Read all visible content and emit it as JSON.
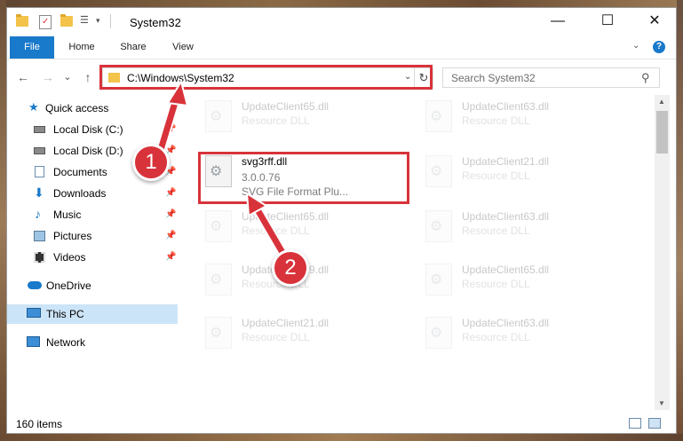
{
  "window": {
    "title": "System32",
    "controls": {
      "minimize": "—",
      "maximize": "☐",
      "close": "✕"
    }
  },
  "ribbon": {
    "tabs": [
      "File",
      "Home",
      "Share",
      "View"
    ],
    "help": "?"
  },
  "navigation": {
    "back": "←",
    "forward": "→",
    "recent": "⌄",
    "up": "↑"
  },
  "address": {
    "path": "C:\\Windows\\System32",
    "dropdown": "⌄",
    "refresh": "↻"
  },
  "search": {
    "placeholder": "Search System32",
    "icon": "search-icon"
  },
  "sidebar": {
    "items": [
      {
        "label": "Quick access",
        "icon": "star-icon"
      },
      {
        "label": "Local Disk (C:)",
        "icon": "drive-icon",
        "pinned": true
      },
      {
        "label": "Local Disk (D:)",
        "icon": "drive-icon",
        "pinned": true
      },
      {
        "label": "Documents",
        "icon": "documents-icon",
        "pinned": true
      },
      {
        "label": "Downloads",
        "icon": "downloads-icon",
        "pinned": true
      },
      {
        "label": "Music",
        "icon": "music-icon",
        "pinned": true
      },
      {
        "label": "Pictures",
        "icon": "pictures-icon",
        "pinned": true
      },
      {
        "label": "Videos",
        "icon": "videos-icon",
        "pinned": true
      },
      {
        "label": "OneDrive",
        "icon": "cloud-icon"
      },
      {
        "label": "This PC",
        "icon": "computer-icon",
        "selected": true
      },
      {
        "label": "Network",
        "icon": "network-icon"
      }
    ]
  },
  "files": {
    "highlighted": {
      "name": "svg3rff.dll",
      "version": "3.0.0.76",
      "description": "SVG File Format Plu..."
    },
    "background": [
      {
        "name": "UpdateClient65.dll",
        "type": "Resource DLL"
      },
      {
        "name": "UpdateClient63.dll",
        "type": "Resource DLL"
      },
      {
        "name": "UpdateClient21.dll",
        "type": "Resource DLL"
      },
      {
        "name": "UpdateClient65.dll",
        "type": "Resource DLL"
      },
      {
        "name": "UpdateClient63.dll",
        "type": "Resource DLL"
      },
      {
        "name": "UpdateClient19.dll",
        "type": "Resource DLL"
      },
      {
        "name": "UpdateClient65.dll",
        "type": "Resource DLL"
      },
      {
        "name": "UpdateClient21.dll",
        "type": "Resource DLL"
      },
      {
        "name": "UpdateClient63.dll",
        "type": "Resource DLL"
      }
    ]
  },
  "status": {
    "count": "160 items"
  },
  "annotations": {
    "step1": "1",
    "step2": "2",
    "color": "#d8333a"
  }
}
